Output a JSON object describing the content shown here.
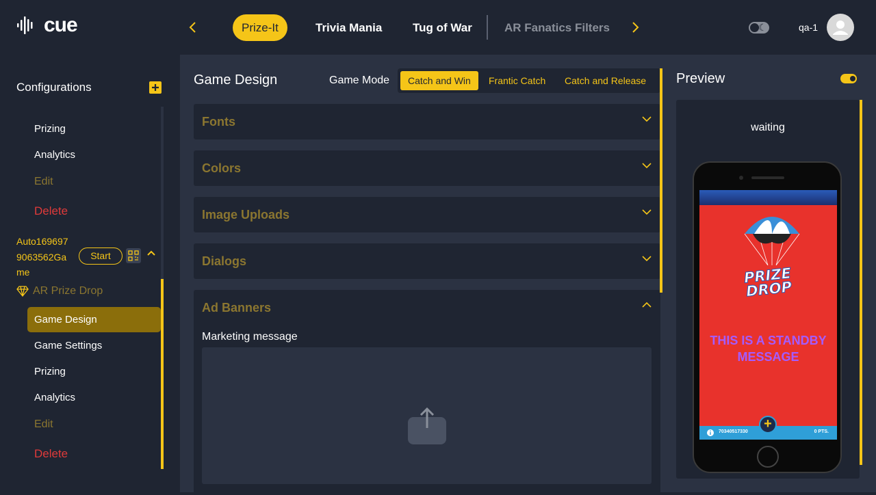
{
  "app": {
    "logo_text": "cue"
  },
  "topnav": {
    "tabs": [
      {
        "label": "Prize-It",
        "active": true
      },
      {
        "label": "Trivia Mania",
        "active": false
      },
      {
        "label": "Tug of War",
        "active": false
      },
      {
        "label": "AR Fanatics Filters",
        "active": false
      }
    ],
    "user_name": "qa-1"
  },
  "sidebar": {
    "title": "Configurations",
    "upper_items": [
      "Prizing",
      "Analytics",
      "Edit",
      "Delete"
    ],
    "game": {
      "name": "Auto1696979063562Game",
      "name_lines": [
        "Auto169697",
        "9063562Ga",
        "me"
      ],
      "start_label": "Start",
      "type_label": "AR Prize Drop"
    },
    "lower_items": [
      "Game Design",
      "Game Settings",
      "Prizing",
      "Analytics",
      "Edit",
      "Delete"
    ]
  },
  "main": {
    "title": "Game Design",
    "mode_label": "Game Mode",
    "modes": [
      {
        "label": "Catch and Win",
        "active": true
      },
      {
        "label": "Frantic Catch",
        "active": false
      },
      {
        "label": "Catch and Release",
        "active": false
      }
    ],
    "panels": [
      "Fonts",
      "Colors",
      "Image Uploads",
      "Dialogs",
      "Ad Banners"
    ],
    "ad_banners": {
      "marketing_label": "Marketing message"
    }
  },
  "preview": {
    "title": "Preview",
    "status": "waiting",
    "logo_line1": "PRIZE",
    "logo_line2": "DROP",
    "standby_line1": "THIS IS A STANDBY",
    "standby_line2": "MESSAGE",
    "bar_id": "70340517330",
    "bar_pts": "0 PTS."
  },
  "colors": {
    "accent": "#f5c518",
    "bg": "#1f2532",
    "panel": "#2b3242",
    "danger": "#e03a3a"
  }
}
